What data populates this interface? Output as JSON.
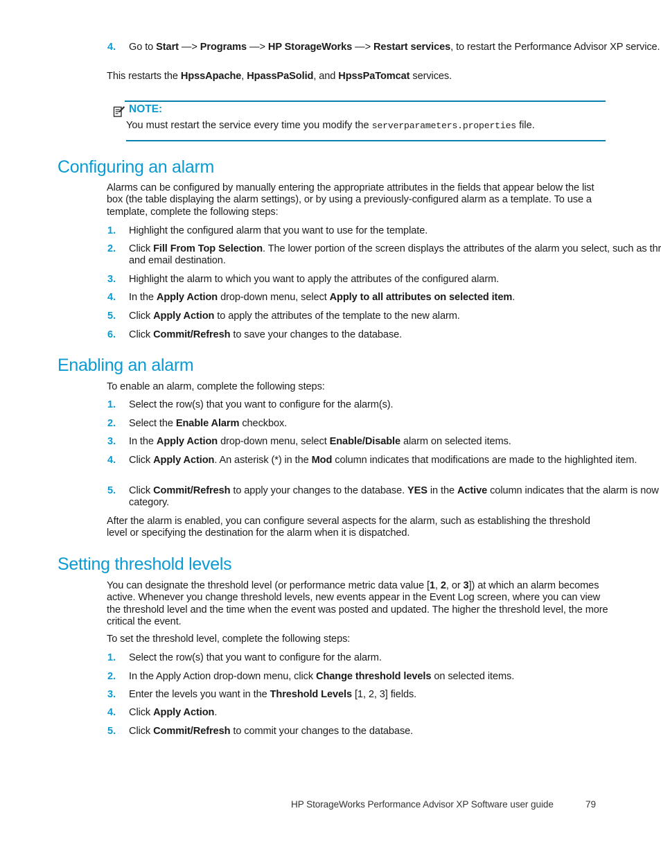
{
  "colors": {
    "heading": "#0b9ad2",
    "rule": "#0b7fae",
    "body_text": "#1b1b1b"
  },
  "continued_step": {
    "number": "4.",
    "line1_prefix": "Go to ",
    "start": "Start",
    "arrow1": " —> ",
    "programs": "Programs",
    "arrow2": " —> ",
    "hp_storageworks": "HP StorageWorks",
    "arrow3": " —> ",
    "restart_services": "Restart services",
    "line1_suffix": ", to restart the Performance Advisor XP service."
  },
  "restart_paragraph": {
    "prefix": "This restarts the ",
    "svc1": "HpssApache",
    "sep1": ", ",
    "svc2": "HpassPaSolid",
    "sep2": ", and ",
    "svc3": "HpssPaTomcat",
    "suffix": " services."
  },
  "note": {
    "icon": "note-pencil-icon",
    "label": "NOTE:",
    "text_prefix": "You must restart the service every time you modify the ",
    "filename": "serverparameters.properties",
    "text_suffix": " file."
  },
  "sections": [
    {
      "heading": "Configuring an alarm",
      "intro": "Alarms can be configured by manually entering the appropriate attributes in the fields that appear below the list box (the table displaying the alarm settings), or by using a previously-configured alarm as a template.  To use a template, complete the following steps:",
      "steps": [
        {
          "number": "1.",
          "parts": [
            {
              "t": "Highlight the configured alarm that you want to use for the template."
            }
          ]
        },
        {
          "number": "2.",
          "parts": [
            {
              "t": "Click "
            },
            {
              "t": "Fill From Top Selection",
              "b": true
            },
            {
              "t": ". The lower portion of the screen displays the attributes of the alarm you select, such as threshold level, dispatch level, and email destination."
            }
          ]
        },
        {
          "number": "3.",
          "parts": [
            {
              "t": "Highlight the alarm to which you want to apply the attributes of the configured alarm."
            }
          ]
        },
        {
          "number": "4.",
          "parts": [
            {
              "t": "In the "
            },
            {
              "t": "Apply Action",
              "b": true
            },
            {
              "t": " drop-down menu, select "
            },
            {
              "t": "Apply to all attributes on selected item",
              "b": true
            },
            {
              "t": "."
            }
          ]
        },
        {
          "number": "5.",
          "parts": [
            {
              "t": "Click "
            },
            {
              "t": "Apply Action",
              "b": true
            },
            {
              "t": " to apply the attributes of the template to the new alarm."
            }
          ]
        },
        {
          "number": "6.",
          "parts": [
            {
              "t": "Click "
            },
            {
              "t": "Commit/Refresh",
              "b": true
            },
            {
              "t": " to save your changes to the database."
            }
          ]
        }
      ]
    },
    {
      "heading": "Enabling an alarm",
      "intro": "To enable an alarm, complete the following steps:",
      "steps": [
        {
          "number": "1.",
          "parts": [
            {
              "t": "Select the row(s) that you want to configure for the alarm(s)."
            }
          ]
        },
        {
          "number": "2.",
          "parts": [
            {
              "t": "Select the "
            },
            {
              "t": "Enable Alarm",
              "b": true
            },
            {
              "t": " checkbox."
            }
          ]
        },
        {
          "number": "3.",
          "parts": [
            {
              "t": "In the "
            },
            {
              "t": "Apply Action",
              "b": true
            },
            {
              "t": " drop-down menu, select "
            },
            {
              "t": "Enable/Disable",
              "b": true
            },
            {
              "t": " alarm on selected items."
            }
          ]
        },
        {
          "number": "4.",
          "parts": [
            {
              "t": "Click "
            },
            {
              "t": "Apply Action",
              "b": true
            },
            {
              "t": ".  An asterisk (*) in the "
            },
            {
              "t": "Mod",
              "b": true
            },
            {
              "t": " column indicates that modifications are made to the highlighted item."
            }
          ]
        },
        {
          "number": "5.",
          "parts": [
            {
              "t": "Click "
            },
            {
              "t": "Commit/Refresh",
              "b": true
            },
            {
              "t": " to apply your changes to the database.  "
            },
            {
              "t": "YES",
              "b": true
            },
            {
              "t": " in the "
            },
            {
              "t": "Active",
              "b": true
            },
            {
              "t": " column indicates that the alarm is now active for that metric category."
            }
          ]
        }
      ],
      "closing": "After the alarm is enabled, you can configure several aspects for the alarm, such as establishing the threshold level or specifying the destination for the alarm when it is dispatched."
    },
    {
      "heading": "Setting threshold levels",
      "intro_parts": [
        {
          "t": "You can designate the threshold level (or performance metric data value ["
        },
        {
          "t": "1",
          "b": true
        },
        {
          "t": ", "
        },
        {
          "t": "2",
          "b": true
        },
        {
          "t": ", or "
        },
        {
          "t": "3",
          "b": true
        },
        {
          "t": "]) at which an alarm becomes active.  Whenever you change threshold levels, new events appear in the Event Log screen, where you can view the threshold level and the time when the event was posted and updated.  The higher the threshold level, the more critical the event."
        }
      ],
      "intro2": "To set the threshold level, complete the following steps:",
      "steps": [
        {
          "number": "1.",
          "parts": [
            {
              "t": "Select the row(s) that you want to configure for the alarm."
            }
          ]
        },
        {
          "number": "2.",
          "parts": [
            {
              "t": "In the Apply Action drop-down menu, click "
            },
            {
              "t": "Change threshold levels",
              "b": true
            },
            {
              "t": " on selected items."
            }
          ]
        },
        {
          "number": "3.",
          "parts": [
            {
              "t": "Enter the levels you want in the "
            },
            {
              "t": "Threshold Levels",
              "b": true
            },
            {
              "t": " [1, 2, 3] fields."
            }
          ]
        },
        {
          "number": "4.",
          "parts": [
            {
              "t": "Click "
            },
            {
              "t": "Apply Action",
              "b": true
            },
            {
              "t": "."
            }
          ]
        },
        {
          "number": "5.",
          "parts": [
            {
              "t": "Click "
            },
            {
              "t": "Commit/Refresh",
              "b": true
            },
            {
              "t": " to commit your changes to the database."
            }
          ]
        }
      ]
    }
  ],
  "footer": {
    "title": "HP StorageWorks Performance Advisor XP Software user guide",
    "page_number": "79"
  }
}
